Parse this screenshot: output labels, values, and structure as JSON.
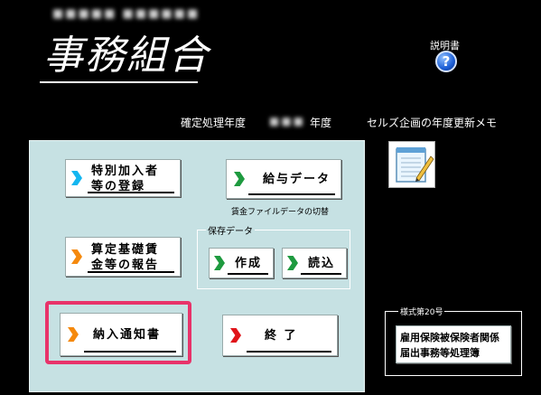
{
  "header": {
    "blurred_text": "■■■■■ ■■■■■■",
    "title": "事務組合",
    "manual_label": "説明書",
    "help_symbol": "?"
  },
  "year_row": {
    "label": "確定処理年度",
    "value": "■■■",
    "suffix": "年度",
    "memo_label": "セルズ企画の年度更新メモ"
  },
  "buttons": {
    "special_join": {
      "line1": "特別加入者",
      "line2": "等の登録"
    },
    "salary": {
      "label": "給与データ",
      "note": "賃金ファイルデータの切替"
    },
    "calc_base": {
      "line1": "算定基礎賃",
      "line2": "金等の報告"
    },
    "save_group_label": "保存データ",
    "create": "作成",
    "load": "読込",
    "payment_notice": "納入通知書",
    "exit": "終 了"
  },
  "form": {
    "label": "様式第20号",
    "line1": "雇用保険被保険者関係",
    "line2": "届出事務等処理簿"
  },
  "colors": {
    "panel": "#c6e1e3",
    "highlight": "#e8336a",
    "cyan": "#14b6f0",
    "green": "#1e9a3f",
    "orange": "#f5890d",
    "red": "#e0141a"
  }
}
